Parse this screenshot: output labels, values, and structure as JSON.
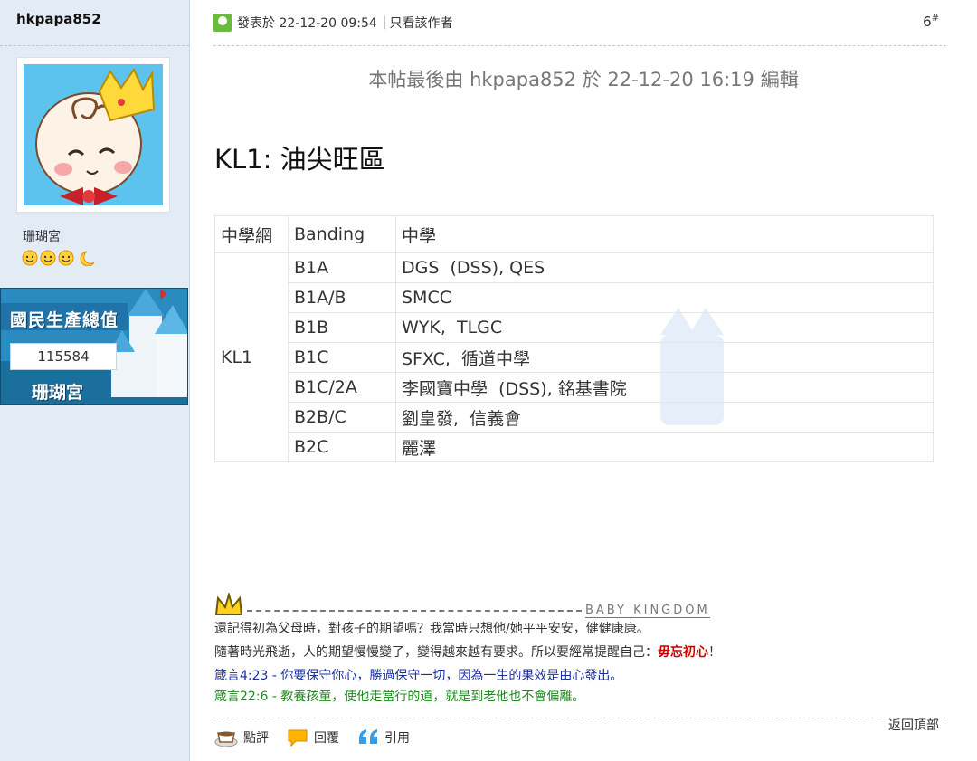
{
  "user": {
    "username": "hkpapa852",
    "group": "珊瑚宮",
    "medal": {
      "title": "國民生產總值",
      "value": "115584",
      "subtitle": "珊瑚宮"
    }
  },
  "post": {
    "posted_label": "發表於 22-12-20 09:54",
    "author_only": "只看該作者",
    "floor": "6",
    "floor_suffix": "#",
    "edit_note": "本帖最後由 hkpapa852 於 22-12-20 16:19 編輯",
    "title": "KL1: 油尖旺區",
    "table": {
      "headers": [
        "中學網",
        "Banding",
        "中學"
      ],
      "group": "KL1",
      "rows": [
        {
          "banding": "B1A",
          "schools": "DGS  (DSS), QES"
        },
        {
          "banding": "B1A/B",
          "schools": "SMCC"
        },
        {
          "banding": "B1B",
          "schools": "WYK,  TLGC"
        },
        {
          "banding": "B1C",
          "schools": "SFXC,  循道中學"
        },
        {
          "banding": "B1C/2A",
          "schools": "李國寶中學  (DSS), 銘基書院"
        },
        {
          "banding": "B2B/C",
          "schools": "劉皇發,  信義會"
        },
        {
          "banding": "B2C",
          "schools": "麗澤"
        }
      ]
    }
  },
  "signature": {
    "brand": "BABY KINGDOM",
    "line1": "還記得初為父母時，對孩子的期望嗎？我當時只想他/她平平安安，健健康康。",
    "line2_prefix": "隨著時光飛逝，人的期望慢慢變了，變得越來越有要求。所以要經常提醒自己：",
    "line2_emphasis": "毋忘初心",
    "line2_suffix": "！",
    "line3": "箴言4:23 - 你要保守你心，勝過保守一切，因為一生的果效是由心發出。",
    "line4": "箴言22:6 - 教養孩童，使他走當行的道，就是到老他也不會偏離。"
  },
  "actions": {
    "rate": "點評",
    "reply": "回覆",
    "quote": "引用",
    "back_top": "返回頂部"
  },
  "colors": {
    "sidebar_bg": "#e3ebf4",
    "online_green": "#6abb3a",
    "emphasis_red": "#cc0000",
    "verse_blue": "#1a2fa0",
    "verse_green": "#1e8a1e"
  }
}
